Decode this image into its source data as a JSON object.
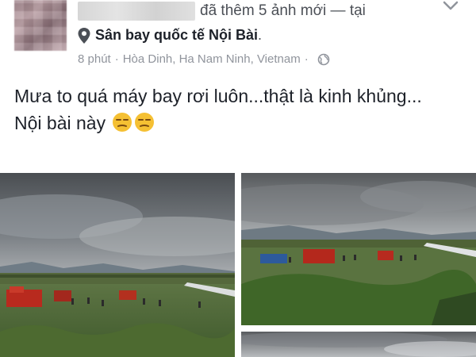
{
  "post": {
    "action_text": "đã thêm 5 ảnh mới — tại",
    "location": "Sân bay quốc tế Nội Bài",
    "location_suffix": ".",
    "time": "8 phút",
    "separator": "·",
    "place": "Hòa Dinh, Ha Nam Ninh, Vietnam",
    "body_line_1": "Mưa to quá máy bay rơi luôn...thật là kinh khủng...",
    "body_line_2": "Nội bài này",
    "emoji_names": [
      "unamused-face-icon",
      "unamused-face-icon"
    ],
    "photo_count": 3
  },
  "icons": {
    "menu": "chevron-down-icon",
    "location": "map-pin-icon",
    "privacy": "globe-icon"
  },
  "colors": {
    "text_primary": "#1d2129",
    "text_secondary": "#4b4f56",
    "text_meta": "#90949c",
    "emoji": "#f5c033"
  }
}
